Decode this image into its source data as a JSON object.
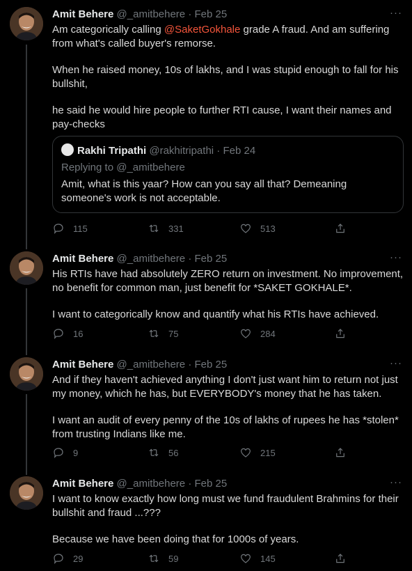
{
  "tweets": [
    {
      "name": "Amit Behere",
      "handle": "@_amitbehere",
      "date": "Feb 25",
      "sep": "·",
      "more": "···",
      "paragraphs": [
        {
          "pre": "Am categorically calling ",
          "mention": "@SaketGokhale",
          "post": " grade A fraud. And am suffering from what's called buyer's remorse."
        },
        {
          "pre": "When he raised money, 10s of lakhs, and I was stupid enough to fall for his bullshit,"
        },
        {
          "pre": "he said he would hire people to further RTI cause, I want their names and pay-checks"
        }
      ],
      "quote": {
        "name": "Rakhi Tripathi",
        "handle": "@rakhitripathi",
        "date": "Feb 24",
        "replying": "Replying to @_amitbehere",
        "text": "Amit, what is this yaar? How can you say all that? Demeaning someone's work is not acceptable."
      },
      "stats": {
        "replies": "115",
        "retweets": "331",
        "likes": "513"
      }
    },
    {
      "name": "Amit Behere",
      "handle": "@_amitbehere",
      "date": "Feb 25",
      "sep": "·",
      "more": "···",
      "paragraphs": [
        {
          "pre": "His RTIs have had absolutely ZERO return on investment. No improvement, no benefit for common man, just benefit for *SAKET GOKHALE*."
        },
        {
          "pre": "I want to categorically know and quantify what his RTIs have achieved."
        }
      ],
      "stats": {
        "replies": "16",
        "retweets": "75",
        "likes": "284"
      }
    },
    {
      "name": "Amit Behere",
      "handle": "@_amitbehere",
      "date": "Feb 25",
      "sep": "·",
      "more": "···",
      "paragraphs": [
        {
          "pre": "And if they haven't achieved anything I don't just want him to return not just my money, which he has, but EVERYBODY's money that he has taken."
        },
        {
          "pre": "I want an audit of every penny of the 10s of lakhs of rupees he has *stolen* from trusting Indians like me."
        }
      ],
      "stats": {
        "replies": "9",
        "retweets": "56",
        "likes": "215"
      }
    },
    {
      "name": "Amit Behere",
      "handle": "@_amitbehere",
      "date": "Feb 25",
      "sep": "·",
      "more": "···",
      "paragraphs": [
        {
          "pre": "I want to know exactly how long must we fund fraudulent Brahmins for their bullshit and fraud ...???"
        },
        {
          "pre": "Because we have been doing that for 1000s of years."
        }
      ],
      "stats": {
        "replies": "29",
        "retweets": "59",
        "likes": "145"
      }
    }
  ],
  "colors": {
    "background": "#000000",
    "text": "#d9d9d9",
    "muted": "#71767b",
    "mention": "#f4553b",
    "border": "#333639"
  },
  "icons": [
    "reply-icon",
    "retweet-icon",
    "like-icon",
    "share-icon",
    "more-icon"
  ]
}
